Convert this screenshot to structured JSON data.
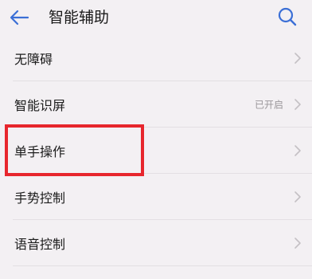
{
  "header": {
    "title": "智能辅助",
    "back_icon": "back-arrow-icon",
    "search_icon": "search-icon",
    "accent_color": "#3b6fd6"
  },
  "items": [
    {
      "label": "无障碍",
      "status": ""
    },
    {
      "label": "智能识屏",
      "status": "已开启"
    },
    {
      "label": "单手操作",
      "status": ""
    },
    {
      "label": "手势控制",
      "status": ""
    },
    {
      "label": "语音控制",
      "status": ""
    }
  ],
  "highlight": {
    "item": "单手操作",
    "color": "#e7262d"
  }
}
